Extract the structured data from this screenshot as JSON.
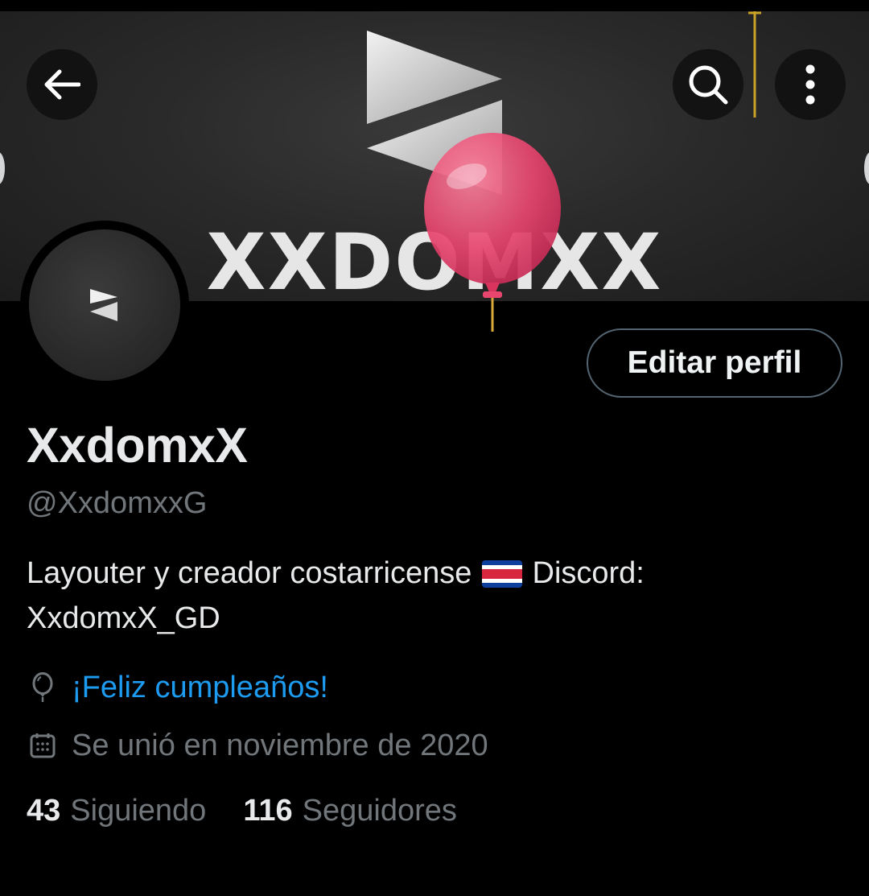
{
  "header": {
    "back_icon": "arrow-left-icon",
    "search_icon": "search-icon",
    "more_icon": "more-vertical-icon"
  },
  "banner": {
    "logo_text": "XXDOMXX",
    "balloon_color": "#e8466f"
  },
  "profile": {
    "edit_button_label": "Editar perfil",
    "display_name": "XxdomxX",
    "handle": "@XxdomxxG",
    "bio_before_flag": "Layouter y creador costarricense ",
    "bio_flag_icon": "costa-rica-flag-icon",
    "bio_after_flag": " Discord: XxdomxX_GD",
    "birthday_text": "¡Feliz cumpleaños!",
    "joined_text": "Se unió en noviembre de 2020"
  },
  "stats": {
    "following_count": "43",
    "following_label": "Siguiendo",
    "followers_count": "116",
    "followers_label": "Seguidores"
  },
  "colors": {
    "background": "#000000",
    "link_blue": "#1d9bf0",
    "muted_gray": "#71767b",
    "button_border": "#536471"
  }
}
